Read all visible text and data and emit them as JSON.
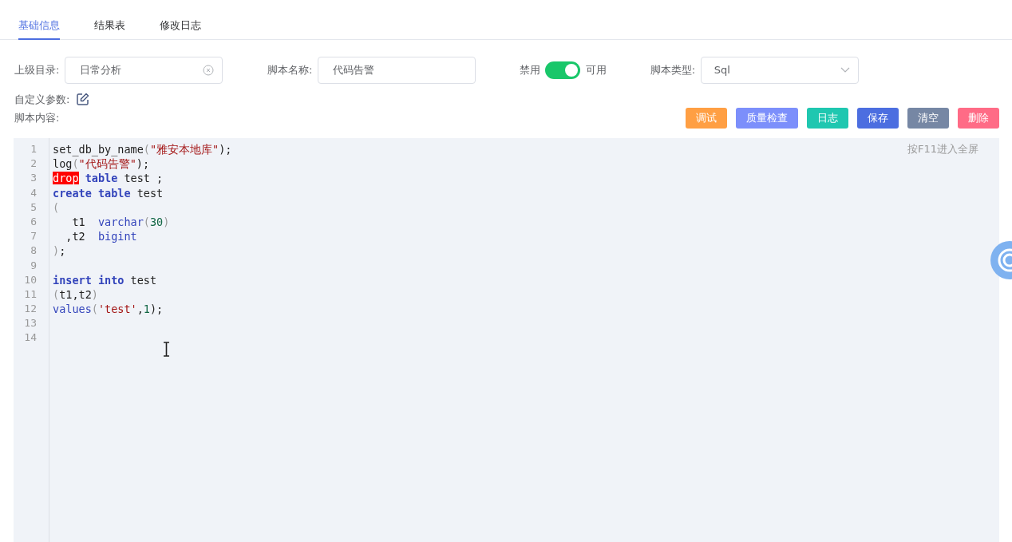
{
  "tabs": [
    {
      "label": "基础信息",
      "selected": true
    },
    {
      "label": "结果表",
      "selected": false
    },
    {
      "label": "修改日志",
      "selected": false
    }
  ],
  "form": {
    "parent_dir": {
      "label": "上级目录:",
      "value": "日常分析"
    },
    "script_name": {
      "label": "脚本名称:",
      "value": "代码告警"
    },
    "status_toggle": {
      "off_label": "禁用",
      "on_label": "可用",
      "on": true
    },
    "script_type": {
      "label": "脚本类型:",
      "value": "Sql"
    }
  },
  "custom_params": {
    "label": "自定义参数:"
  },
  "content_label": "脚本内容:",
  "buttons": [
    {
      "label": "调试",
      "color": "#ff9f43"
    },
    {
      "label": "质量检查",
      "color": "#7c8ffb"
    },
    {
      "label": "日志",
      "color": "#1fc7b0"
    },
    {
      "label": "保存",
      "color": "#4c6ee0"
    },
    {
      "label": "清空",
      "color": "#7687a4"
    },
    {
      "label": "删除",
      "color": "#ff6b86"
    }
  ],
  "editor": {
    "hint": "按F11进入全屏",
    "lines": [
      {
        "number": "1",
        "tokens": [
          {
            "text": "set_db_by_name",
            "kind": "text"
          },
          {
            "text": "(",
            "kind": "punct"
          },
          {
            "text": "\"雅安本地库\"",
            "kind": "str"
          },
          {
            "text": ");",
            "kind": "text"
          }
        ]
      },
      {
        "number": "2",
        "tokens": [
          {
            "text": "log",
            "kind": "text"
          },
          {
            "text": "(",
            "kind": "punct"
          },
          {
            "text": "\"代码告警\"",
            "kind": "str"
          },
          {
            "text": ");",
            "kind": "text"
          }
        ]
      },
      {
        "number": "3",
        "tokens": [
          {
            "text": "drop",
            "kind": "error"
          },
          {
            "text": " table",
            "kind": "kw"
          },
          {
            "text": " test ;",
            "kind": "text"
          }
        ]
      },
      {
        "number": "4",
        "tokens": [
          {
            "text": "create table",
            "kind": "kw"
          },
          {
            "text": " test",
            "kind": "text"
          }
        ]
      },
      {
        "number": "5",
        "tokens": [
          {
            "text": "(",
            "kind": "punct"
          }
        ]
      },
      {
        "number": "6",
        "tokens": [
          {
            "text": "   t1  ",
            "kind": "text"
          },
          {
            "text": "varchar",
            "kind": "type"
          },
          {
            "text": "(",
            "kind": "punct"
          },
          {
            "text": "30",
            "kind": "num"
          },
          {
            "text": ")",
            "kind": "punct"
          }
        ]
      },
      {
        "number": "7",
        "tokens": [
          {
            "text": "  ,t2  ",
            "kind": "text"
          },
          {
            "text": "bigint",
            "kind": "type"
          }
        ]
      },
      {
        "number": "8",
        "tokens": [
          {
            "text": ")",
            "kind": "punct"
          },
          {
            "text": ";",
            "kind": "text"
          }
        ]
      },
      {
        "number": "9"
      },
      {
        "number": "10",
        "tokens": [
          {
            "text": "insert into",
            "kind": "kw"
          },
          {
            "text": " test",
            "kind": "text"
          }
        ]
      },
      {
        "number": "11",
        "tokens": [
          {
            "text": "(",
            "kind": "punct"
          },
          {
            "text": "t1,t2",
            "kind": "text"
          },
          {
            "text": ")",
            "kind": "punct"
          }
        ]
      },
      {
        "number": "12",
        "tokens": [
          {
            "text": "values",
            "kind": "type"
          },
          {
            "text": "(",
            "kind": "punct"
          },
          {
            "text": "'test'",
            "kind": "str"
          },
          {
            "text": ",",
            "kind": "text"
          },
          {
            "text": "1",
            "kind": "num"
          },
          {
            "text": ");",
            "kind": "text"
          }
        ]
      },
      {
        "number": "13"
      },
      {
        "number": "14"
      }
    ]
  }
}
